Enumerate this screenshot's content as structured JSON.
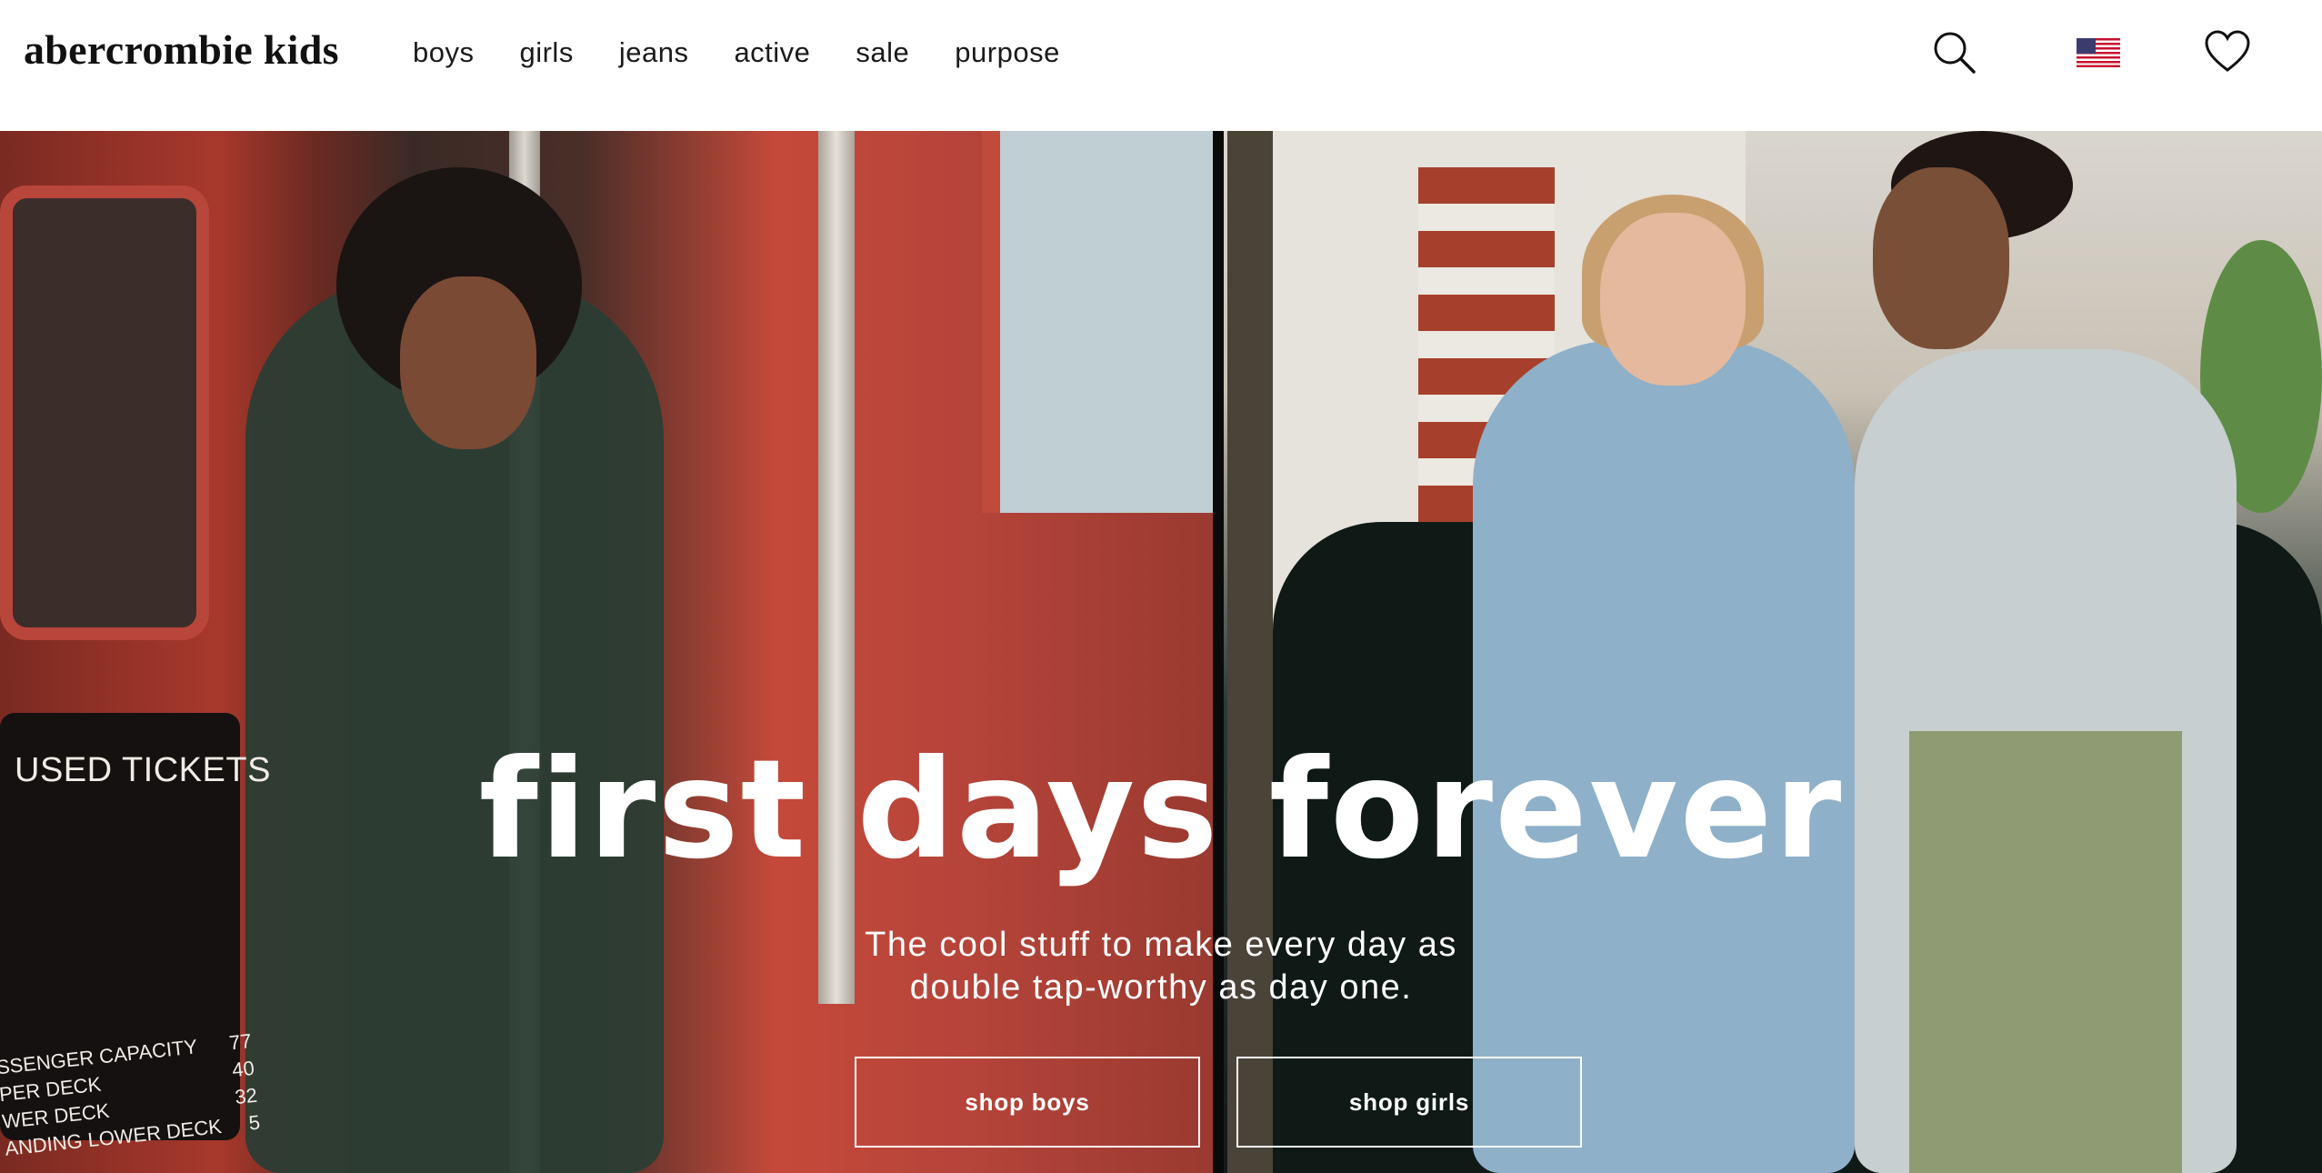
{
  "header": {
    "logo": "abercrombie kids",
    "nav": [
      {
        "label": "boys"
      },
      {
        "label": "girls"
      },
      {
        "label": "jeans"
      },
      {
        "label": "active"
      },
      {
        "label": "sale"
      },
      {
        "label": "purpose"
      }
    ],
    "icons": [
      "search-icon",
      "us-flag-icon",
      "heart-icon"
    ]
  },
  "hero": {
    "headline": "first days forever",
    "subline_1": "The cool stuff to make every day as",
    "subline_2": "double tap-worthy as day one.",
    "cta_boys": "shop boys",
    "cta_girls": "shop girls",
    "photo_text": {
      "sign": "USED TICKETS",
      "capacity": [
        {
          "label": "SSENGER CAPACITY",
          "value": "77"
        },
        {
          "label": "PER DECK",
          "value": "40"
        },
        {
          "label": "WER DECK",
          "value": "32"
        },
        {
          "label": "ANDING LOWER DECK",
          "value": "5"
        }
      ]
    }
  },
  "colors": {
    "bus_red": "#b5443a",
    "text_dark": "#1a1a1a",
    "overlay_text": "#ffffff"
  }
}
